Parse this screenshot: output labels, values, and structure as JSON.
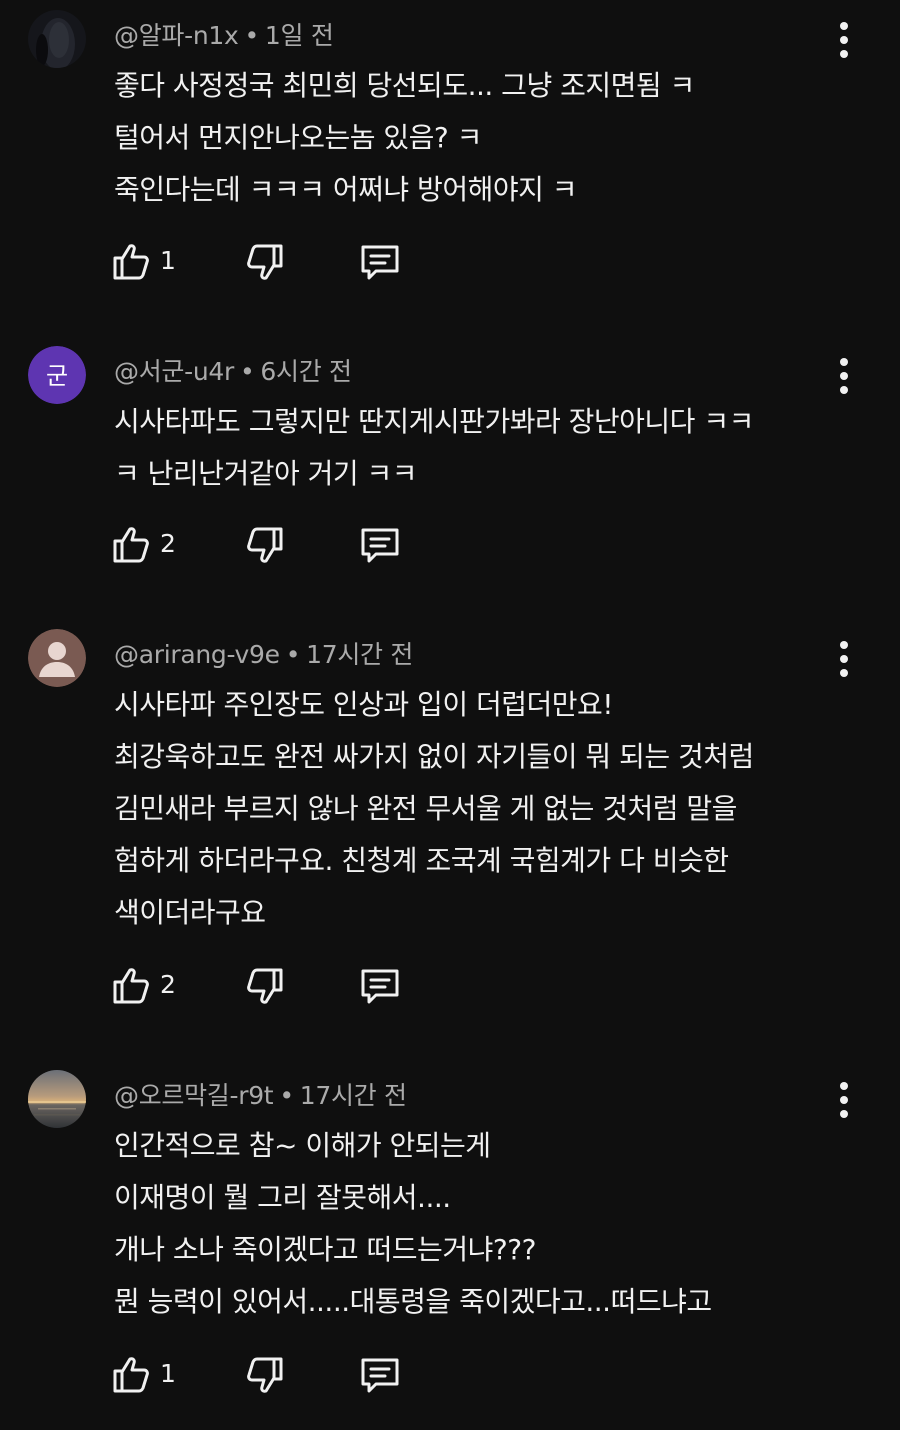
{
  "comments": [
    {
      "handle": "@알파-n1x",
      "time": "1일 전",
      "avatar": {
        "type": "photo-dark",
        "color": "#1c1e26"
      },
      "lines": [
        "좋다 사정정국 최민희 당선되도... 그냥 조지면됨 ㅋ",
        "털어서 먼지안나오는놈 있음? ㅋ",
        "죽인다는데 ㅋㅋㅋ 어쩌냐 방어해야지 ㅋ"
      ],
      "likes": "1"
    },
    {
      "handle": "@서군-u4r",
      "time": "6시간 전",
      "avatar": {
        "type": "letter",
        "letter": "군",
        "color": "#5e35b1"
      },
      "lines": [
        "시사타파도 그렇지만 딴지게시판가봐라 장난아니다 ㅋㅋ",
        "ㅋ 난리난거같아 거기 ㅋㅋ"
      ],
      "likes": "2"
    },
    {
      "handle": "@arirang-v9e",
      "time": "17시간 전",
      "avatar": {
        "type": "default-person",
        "color": "#7a5a52"
      },
      "lines": [
        "시사타파 주인장도 인상과 입이 더럽더만요!",
        "최강욱하고도 완전 싸가지 없이 자기들이 뭐 되는 것처럼",
        "김민새라 부르지 않나 완전 무서울 게 없는 것처럼 말을",
        "험하게 하더라구요. 친청계 조국계 국힘계가 다 비슷한",
        "색이더라구요"
      ],
      "likes": "2"
    },
    {
      "handle": "@오르막길-r9t",
      "time": "17시간 전",
      "avatar": {
        "type": "photo-sunset",
        "color": "#8a7a6a"
      },
      "lines": [
        "인간적으로 참~ 이해가 안되는게",
        "이재명이 뭘 그리 잘못해서....",
        "개나 소나 죽이겠다고 떠드는거냐???",
        "뭔 능력이 있어서.....대통령을 죽이겠다고...떠드냐고"
      ],
      "likes": "1"
    }
  ],
  "icons": {
    "like": "thumbs-up-icon",
    "dislike": "thumbs-down-icon",
    "reply": "reply-icon",
    "menu": "more-vert-icon"
  },
  "colors": {
    "background": "#0f0f0f",
    "text": "#f1f1f1",
    "meta": "#aaaaaa"
  }
}
